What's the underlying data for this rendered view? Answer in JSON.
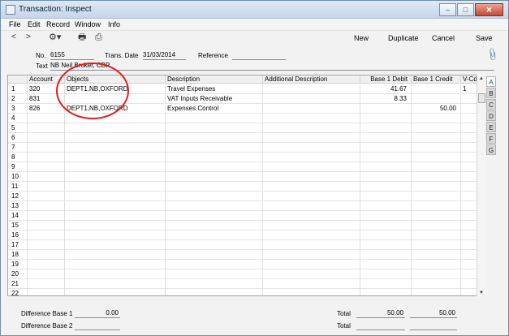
{
  "window": {
    "title": "Transaction: Inspect",
    "buttons": {
      "minimize": "–",
      "maximize": "□",
      "close": "✕"
    }
  },
  "menubar": {
    "items": [
      "File",
      "Edit",
      "Record",
      "Window",
      "Info"
    ]
  },
  "toolbar": {
    "prev": "<",
    "next": ">",
    "actions": {
      "new": "New",
      "duplicate": "Duplicate",
      "cancel": "Cancel",
      "save": "Save"
    },
    "icons": {
      "settings": "⚙▾",
      "print": "🖶",
      "preview": "⎙"
    }
  },
  "header": {
    "no_label": "No.",
    "no_value": "6155",
    "trans_date_label": "Trans. Date",
    "trans_date_value": "31/03/2014",
    "reference_label": "Reference",
    "reference_value": "",
    "text_label": "Text",
    "text_value": "NB Neil Broker, CBP"
  },
  "grid": {
    "headers": [
      "Account",
      "Objects",
      "Description",
      "Additional Description",
      "Base 1 Debit",
      "Base 1 Credit",
      "V-Cd"
    ],
    "rows": [
      {
        "n": "1",
        "account": "320",
        "objects": "DEPT1,NB,OXFORD",
        "description": "Travel Expenses",
        "additional": "",
        "debit": "41.67",
        "credit": "",
        "vcd": "1"
      },
      {
        "n": "2",
        "account": "831",
        "objects": "",
        "description": "VAT Inputs Receivable",
        "additional": "",
        "debit": "8.33",
        "credit": "",
        "vcd": ""
      },
      {
        "n": "3",
        "account": "826",
        "objects": "DEPT1,NB,OXFORD",
        "description": "Expenses Control",
        "additional": "",
        "debit": "",
        "credit": "50.00",
        "vcd": ""
      },
      {
        "n": "4"
      },
      {
        "n": "5"
      },
      {
        "n": "6"
      },
      {
        "n": "7"
      },
      {
        "n": "8"
      },
      {
        "n": "9"
      },
      {
        "n": "10"
      },
      {
        "n": "11"
      },
      {
        "n": "12"
      },
      {
        "n": "13"
      },
      {
        "n": "14"
      },
      {
        "n": "15"
      },
      {
        "n": "16"
      },
      {
        "n": "17"
      },
      {
        "n": "18"
      },
      {
        "n": "19"
      },
      {
        "n": "20"
      },
      {
        "n": "21"
      },
      {
        "n": "22"
      }
    ]
  },
  "tabs": [
    "A",
    "B",
    "C",
    "D",
    "E",
    "F",
    "G"
  ],
  "footer": {
    "diff1_label": "Difference Base 1",
    "diff1_value": "0.00",
    "diff2_label": "Difference Base 2",
    "diff2_value": "",
    "total_label": "Total",
    "total_debit_1": "50.00",
    "total_credit_1": "50.00",
    "total_debit_2": "",
    "total_credit_2": ""
  },
  "colors": {
    "annotation": "#e31d1d",
    "title_gradient_top": "#dfe9f5"
  }
}
